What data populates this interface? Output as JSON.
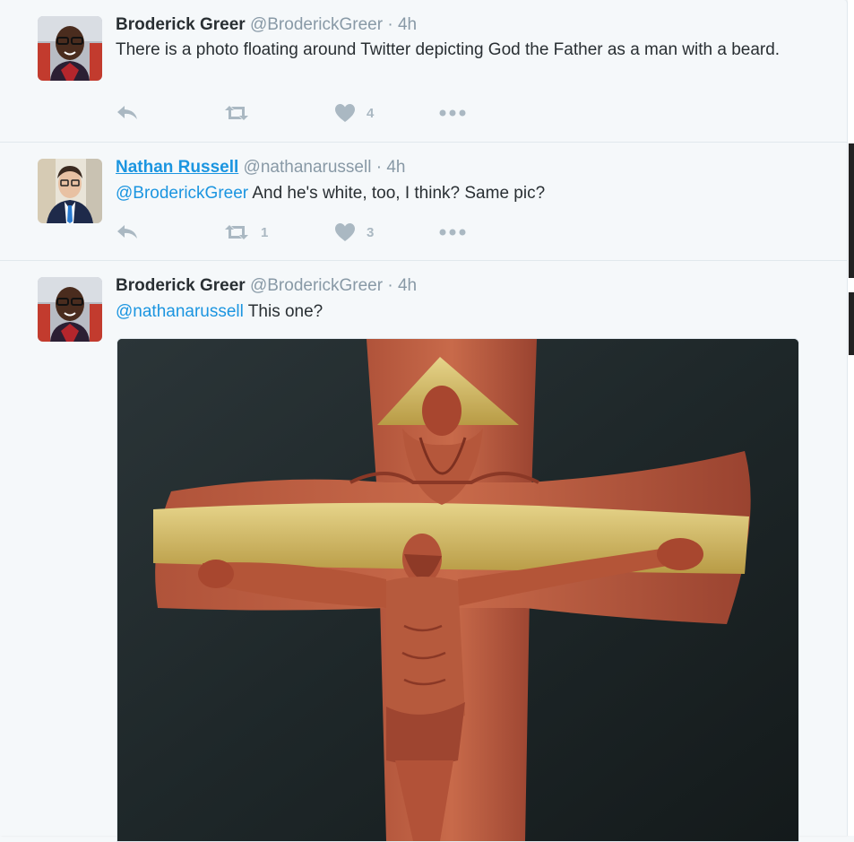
{
  "tweets": [
    {
      "name": "Broderick Greer",
      "handle": "@BroderickGreer",
      "sep": "·",
      "time": "4h",
      "text": "There is a photo floating around Twitter depicting God the Father as a man with a beard.",
      "reply_count": "",
      "retweet_count": "",
      "like_count": "4"
    },
    {
      "name": "Nathan Russell",
      "handle": "@nathanarussell",
      "sep": "·",
      "time": "4h",
      "mention": "@BroderickGreer",
      "text": " And he's white, too, I think? Same pic?",
      "reply_count": "",
      "retweet_count": "1",
      "like_count": "3"
    },
    {
      "name": "Broderick Greer",
      "handle": "@BroderickGreer",
      "sep": "·",
      "time": "4h",
      "mention": "@nathanarussell",
      "text": " This one?",
      "media": "crucifix-image"
    }
  ],
  "icons": {
    "reply": "reply-icon",
    "retweet": "retweet-icon",
    "like": "heart-icon",
    "more": "more-dots-icon"
  },
  "colors": {
    "link": "#1b95e0",
    "muted": "#8899a6",
    "icon": "#aab8c2",
    "background": "#f5f8fa"
  }
}
